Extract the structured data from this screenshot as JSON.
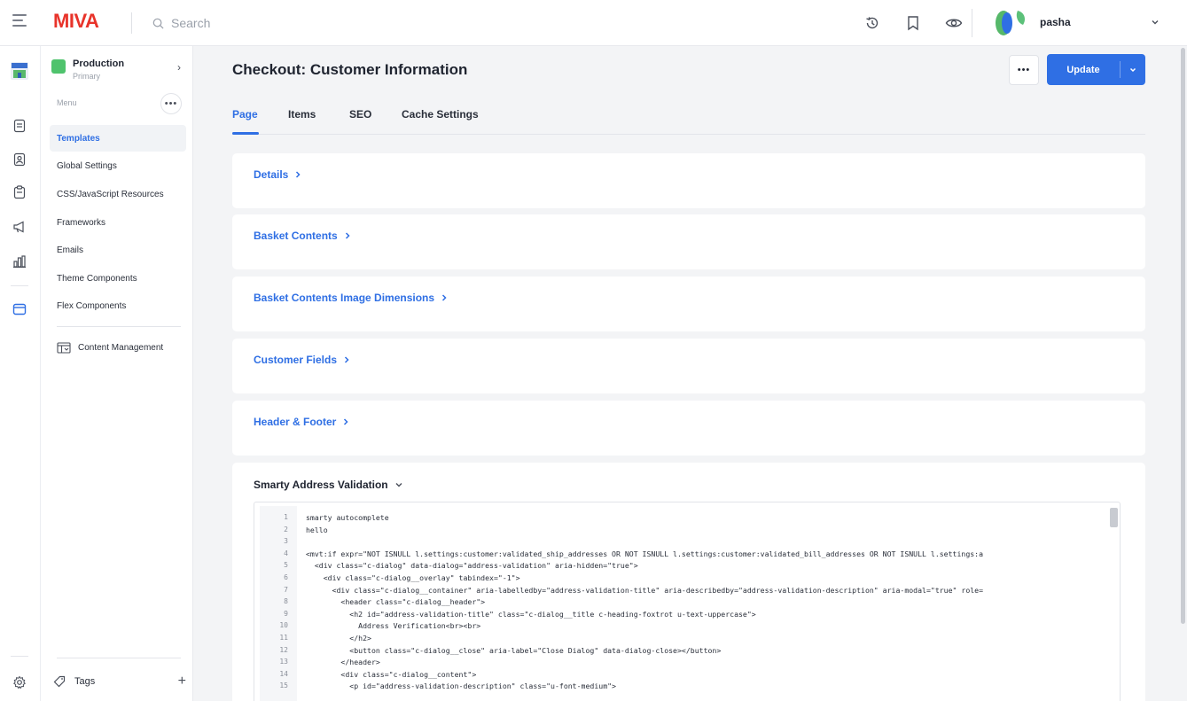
{
  "app": {
    "logo_text": "MIVA",
    "brand_color": "#e8332a",
    "accent_color": "#2f6fe4"
  },
  "topbar": {
    "search_placeholder": "Search",
    "icons": [
      "history-icon",
      "bookmark-icon",
      "eye-icon"
    ],
    "user": {
      "name": "pasha"
    }
  },
  "sidebar": {
    "store": {
      "name": "Production",
      "subtitle": "Primary"
    },
    "menu_label": "Menu",
    "items": [
      {
        "label": "Templates",
        "active": true
      },
      {
        "label": "Global Settings"
      },
      {
        "label": "CSS/JavaScript Resources"
      },
      {
        "label": "Frameworks"
      },
      {
        "label": "Emails"
      },
      {
        "label": "Theme Components"
      },
      {
        "label": "Flex Components"
      }
    ],
    "content_management": "Content Management",
    "tags_label": "Tags"
  },
  "main": {
    "title": "Checkout: Customer Information",
    "update_label": "Update",
    "tabs": [
      {
        "label": "Page",
        "active": true
      },
      {
        "label": "Items"
      },
      {
        "label": "SEO"
      },
      {
        "label": "Cache Settings"
      }
    ],
    "sections": [
      {
        "title": "Details"
      },
      {
        "title": "Basket Contents"
      },
      {
        "title": "Basket Contents Image Dimensions"
      },
      {
        "title": "Customer Fields"
      },
      {
        "title": "Header & Footer"
      }
    ],
    "open_section": {
      "title": "Smarty Address Validation",
      "code_lines": [
        {
          "n": "1",
          "text": "smarty autocomplete"
        },
        {
          "n": "2",
          "text": "hello"
        },
        {
          "n": "3",
          "text": ""
        },
        {
          "n": "4",
          "text": "<mvt:if expr=\"NOT ISNULL l.settings:customer:validated_ship_addresses OR NOT ISNULL l.settings:customer:validated_bill_addresses OR NOT ISNULL l.settings:a"
        },
        {
          "n": "5",
          "text": "  <div class=\"c-dialog\" data-dialog=\"address-validation\" aria-hidden=\"true\">"
        },
        {
          "n": "6",
          "text": "    <div class=\"c-dialog__overlay\" tabindex=\"-1\">"
        },
        {
          "n": "7",
          "text": "      <div class=\"c-dialog__container\" aria-labelledby=\"address-validation-title\" aria-describedby=\"address-validation-description\" aria-modal=\"true\" role="
        },
        {
          "n": "8",
          "text": "        <header class=\"c-dialog__header\">"
        },
        {
          "n": "9",
          "text": "          <h2 id=\"address-validation-title\" class=\"c-dialog__title c-heading-foxtrot u-text-uppercase\">"
        },
        {
          "n": "10",
          "text": "            Address Verification<br><br>"
        },
        {
          "n": "11",
          "text": "          </h2>"
        },
        {
          "n": "12",
          "text": "          <button class=\"c-dialog__close\" aria-label=\"Close Dialog\" data-dialog-close></button>"
        },
        {
          "n": "13",
          "text": "        </header>"
        },
        {
          "n": "14",
          "text": "        <div class=\"c-dialog__content\">"
        },
        {
          "n": "15",
          "text": "          <p id=\"address-validation-description\" class=\"u-font-medium\">"
        }
      ]
    }
  }
}
